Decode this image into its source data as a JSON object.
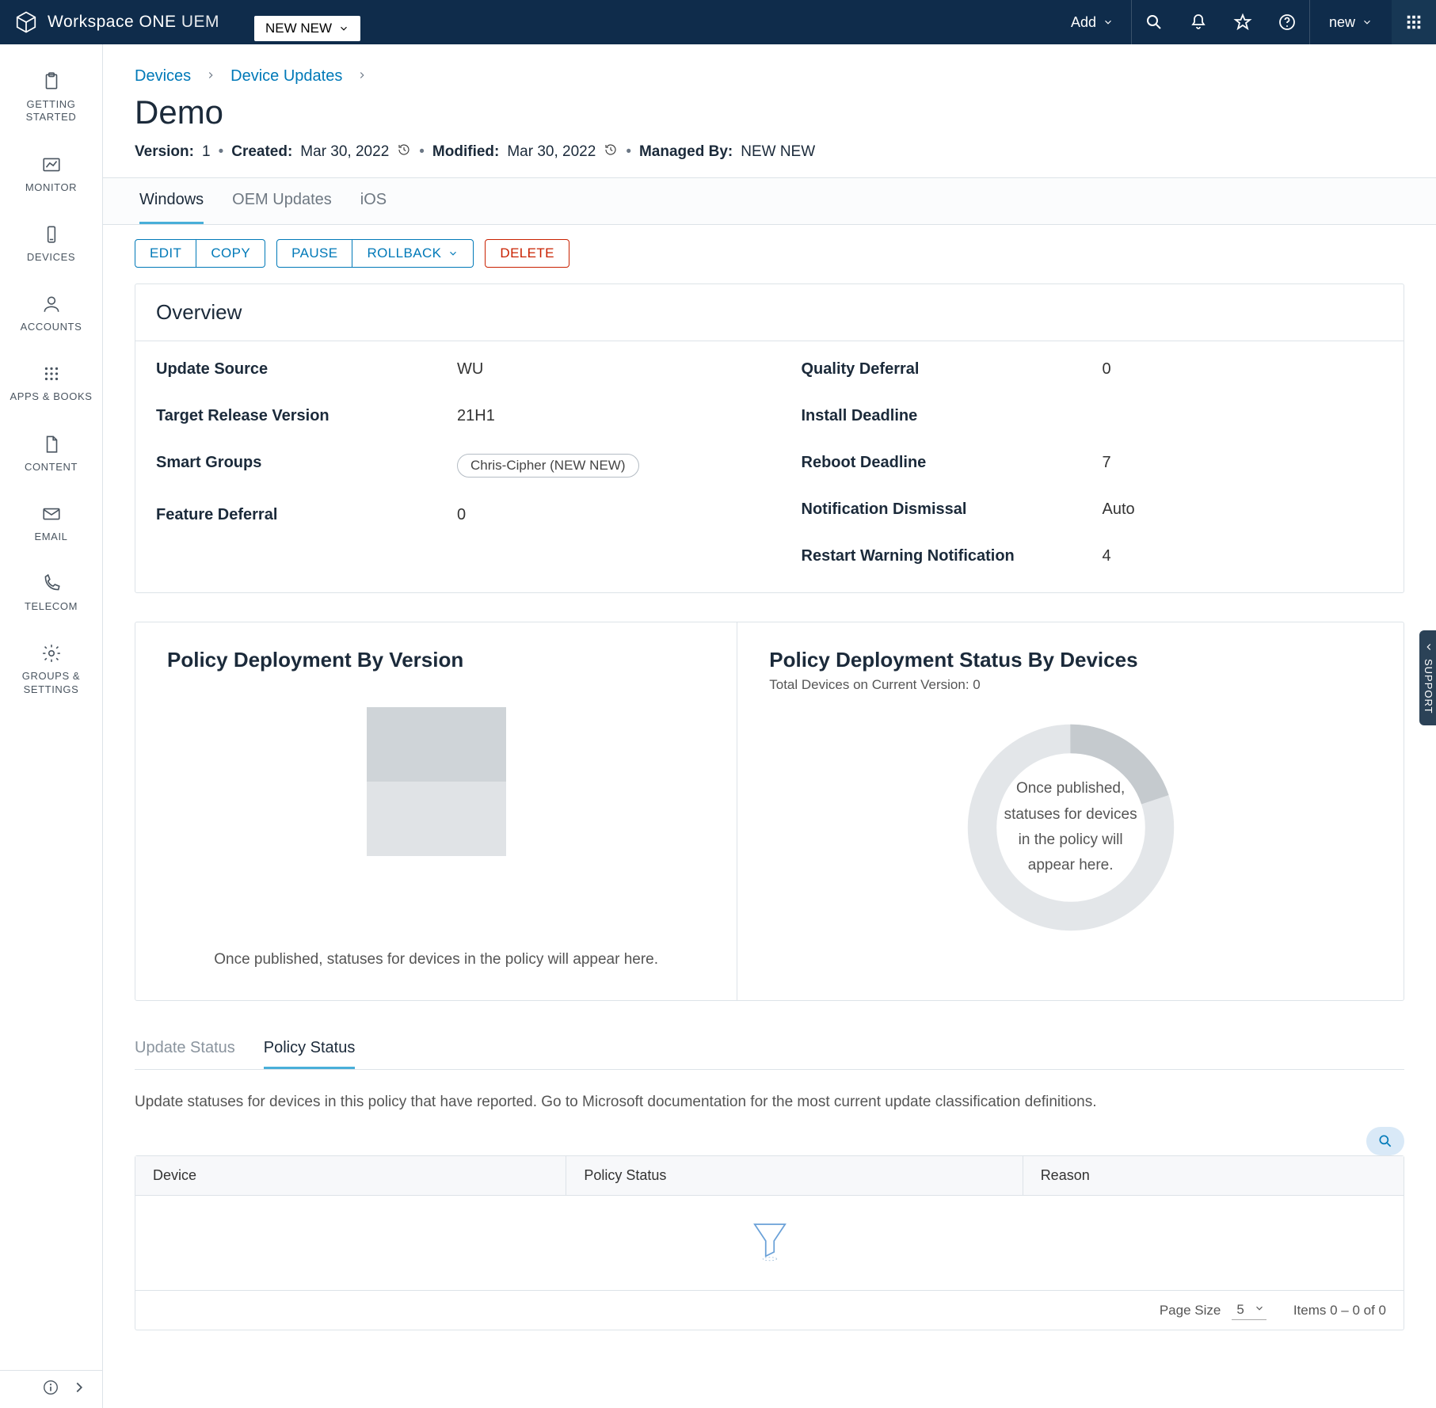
{
  "app": {
    "name_primary": "Workspace ONE",
    "name_secondary": "UEM",
    "org_switch": "NEW NEW",
    "add_label": "Add",
    "user_label": "new"
  },
  "sidebar": {
    "items": [
      {
        "label": "GETTING STARTED",
        "icon": "clipboard"
      },
      {
        "label": "MONITOR",
        "icon": "chart-line"
      },
      {
        "label": "DEVICES",
        "icon": "device"
      },
      {
        "label": "ACCOUNTS",
        "icon": "person"
      },
      {
        "label": "APPS & BOOKS",
        "icon": "grid"
      },
      {
        "label": "CONTENT",
        "icon": "file"
      },
      {
        "label": "EMAIL",
        "icon": "mail"
      },
      {
        "label": "TELECOM",
        "icon": "phone"
      },
      {
        "label": "GROUPS & SETTINGS",
        "icon": "gear"
      }
    ]
  },
  "breadcrumbs": [
    {
      "label": "Devices"
    },
    {
      "label": "Device Updates"
    }
  ],
  "page": {
    "title": "Demo",
    "meta": {
      "version_label": "Version",
      "version_value": "1",
      "created_label": "Created",
      "created_value": "Mar 30, 2022",
      "modified_label": "Modified",
      "modified_value": "Mar 30, 2022",
      "managed_label": "Managed By",
      "managed_value": "NEW NEW"
    }
  },
  "tabs": {
    "items": [
      "Windows",
      "OEM Updates",
      "iOS"
    ],
    "active": 0
  },
  "actions": {
    "edit": "EDIT",
    "copy": "COPY",
    "pause": "PAUSE",
    "rollback": "ROLLBACK",
    "delete": "DELETE"
  },
  "overview": {
    "title": "Overview",
    "left": [
      {
        "k": "Update Source",
        "v": "WU"
      },
      {
        "k": "Target Release Version",
        "v": "21H1"
      },
      {
        "k": "Smart Groups",
        "chip": "Chris-Cipher (NEW NEW)"
      },
      {
        "k": "Feature Deferral",
        "v": "0"
      }
    ],
    "right": [
      {
        "k": "Quality Deferral",
        "v": "0"
      },
      {
        "k": "Install Deadline",
        "v": ""
      },
      {
        "k": "Reboot Deadline",
        "v": "7"
      },
      {
        "k": "Notification Dismissal",
        "v": "Auto"
      },
      {
        "k": "Restart Warning Notification",
        "v": "4"
      }
    ]
  },
  "deployment": {
    "version_title": "Policy Deployment By Version",
    "version_note": "Once published, statuses for devices in the policy will appear here.",
    "devices_title": "Policy Deployment Status By Devices",
    "devices_sub_prefix": "Total Devices on Current Version:",
    "devices_sub_value": "0",
    "donut_note": "Once published, statuses for devices in the policy will appear here."
  },
  "subtabs": {
    "items": [
      "Update Status",
      "Policy Status"
    ],
    "active": 1,
    "description": "Update statuses for devices in this policy that have reported. Go to Microsoft documentation for the most current update classification definitions."
  },
  "table": {
    "cols": [
      "Device",
      "Policy Status",
      "Reason"
    ],
    "page_size_label": "Page Size",
    "page_size_value": "5",
    "items_text": "Items 0 – 0 of 0"
  },
  "support_tab": "SUPPORT",
  "chart_data": [
    {
      "type": "bar",
      "title": "Policy Deployment By Version",
      "categories": [],
      "values": [],
      "note": "Once published, statuses for devices in the policy will appear here."
    },
    {
      "type": "pie",
      "title": "Policy Deployment Status By Devices",
      "total": 0,
      "series": [],
      "note": "Once published, statuses for devices in the policy will appear here."
    }
  ]
}
